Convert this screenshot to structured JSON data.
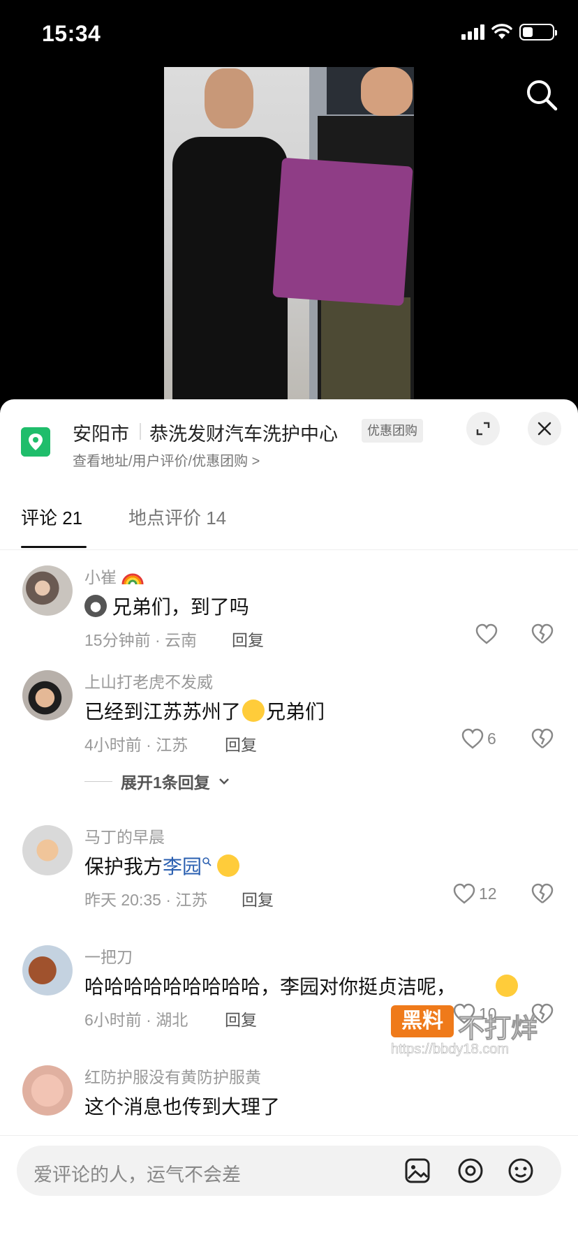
{
  "status_bar": {
    "time": "15:34",
    "battery_level": 0.35
  },
  "location": {
    "city": "安阳市",
    "name": "恭洗发财汽车洗护中心",
    "badge": "优惠团购",
    "links": "查看地址/用户评价/优惠团购 >"
  },
  "tabs": [
    {
      "label": "评论 21"
    },
    {
      "label": "地点评价 14"
    }
  ],
  "comments": [
    {
      "user": "小崔",
      "text": "兄弟们，到了吗",
      "time": "15分钟前 · 云南",
      "reply": "回复",
      "likes": ""
    },
    {
      "user": "上山打老虎不发威",
      "text_a": "已经到江苏苏州了",
      "text_b": "兄弟们",
      "time": "4小时前 · 江苏",
      "reply": "回复",
      "likes": "6",
      "expand": "展开1条回复"
    },
    {
      "user": "马丁的早晨",
      "text_a": "保护我方",
      "link": "李园",
      "time": "昨天 20:35 · 江苏",
      "reply": "回复",
      "likes": "12"
    },
    {
      "user": "一把刀",
      "text": "哈哈哈哈哈哈哈哈哈，李园对你挺贞洁呢，",
      "time": "6小时前 · 湖北",
      "reply": "回复",
      "likes": "10"
    },
    {
      "user": "红防护服没有黄防护服黄",
      "text": "这个消息也传到大理了"
    }
  ],
  "input": {
    "placeholder": "爱评论的人，运气不会差"
  },
  "watermark": {
    "brand": "黑料",
    "slogan": "不打烊",
    "url": "https://bbdy18.com"
  },
  "colors": {
    "accent_green": "#1fbd6b",
    "link_blue": "#2a5fb0",
    "watermark_orange": "#ef7a1a"
  }
}
